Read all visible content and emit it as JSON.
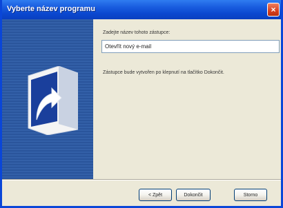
{
  "window": {
    "title": "Vyberte název programu",
    "close_glyph": "×"
  },
  "content": {
    "prompt_label": "Zadejte název tohoto zástupce:",
    "name_value": "Otevřít nový e-mail",
    "info_text": "Zástupce bude vytvořen po klepnutí na tlačítko Dokončit."
  },
  "buttons": {
    "back": "< Zpět",
    "finish": "Dokončit",
    "cancel": "Storno"
  },
  "colors": {
    "titlebar": "#0b48d0",
    "side_panel": "#3360a8",
    "dialog_bg": "#ece9d8"
  },
  "icons": {
    "side_graphic": "shortcut-arrow-icon",
    "close": "close-icon"
  }
}
